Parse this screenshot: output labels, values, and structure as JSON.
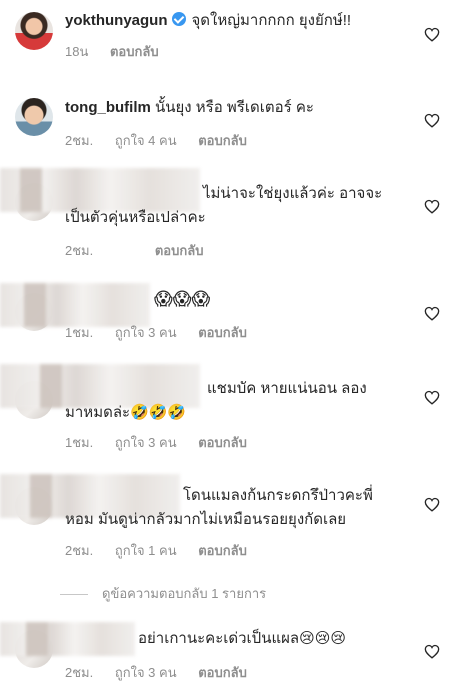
{
  "comments": [
    {
      "user": "yokthunyagun",
      "verified": true,
      "text": "จุดใหญ่มากกกก ยุงยักษ์!!",
      "time": "18น",
      "likes": "",
      "reply": "ตอบกลับ"
    },
    {
      "user": "tong_bufilm",
      "text": "นั้นยุง หรือ พรีเดเตอร์ คะ",
      "time": "2ชม.",
      "likes": "ถูกใจ 4 คน",
      "reply": "ตอบกลับ"
    },
    {
      "user": "",
      "text_line1": "ไม่น่าจะใช่ยุงแล้วค่ะ อาจจะ",
      "text_line2": "เป็นตัวคุ่นหรือเปล่าคะ",
      "time": "2ชม.",
      "likes": "",
      "reply": "ตอบกลับ"
    },
    {
      "user": "",
      "text": "😱😱😱",
      "time": "1ชม.",
      "likes": "ถูกใจ 3 คน",
      "reply": "ตอบกลับ"
    },
    {
      "user": "",
      "text_line1": "แชมบัค หายแน่นอน ลอง",
      "text_line2": "มาหมดล่ะ🤣🤣🤣",
      "time": "1ชม.",
      "likes": "ถูกใจ 3 คน",
      "reply": "ตอบกลับ"
    },
    {
      "user": "",
      "text_line1": "โดนแมลงก้นกระดกรึป่าวคะพี่",
      "text_line2": "หอม มันดูน่ากลัวมากไม่เหมือนรอยยุงกัดเลย",
      "time": "2ชม.",
      "likes": "ถูกใจ 1 คน",
      "reply": "ตอบกลับ"
    },
    {
      "user": "",
      "text": "อย่าเกานะคะเด่วเป็นแผล😢😢😢",
      "time": "2ชม.",
      "likes": "ถูกใจ 3 คน",
      "reply": "ตอบกลับ"
    }
  ],
  "view_replies": "ดูข้อความตอบกลับ 1 รายการ",
  "icons": {
    "like": "heart-outline-icon",
    "verified": "verified-badge-icon"
  },
  "colors": {
    "text": "#262626",
    "meta": "#8e8e8e",
    "verified": "#3897f0"
  }
}
